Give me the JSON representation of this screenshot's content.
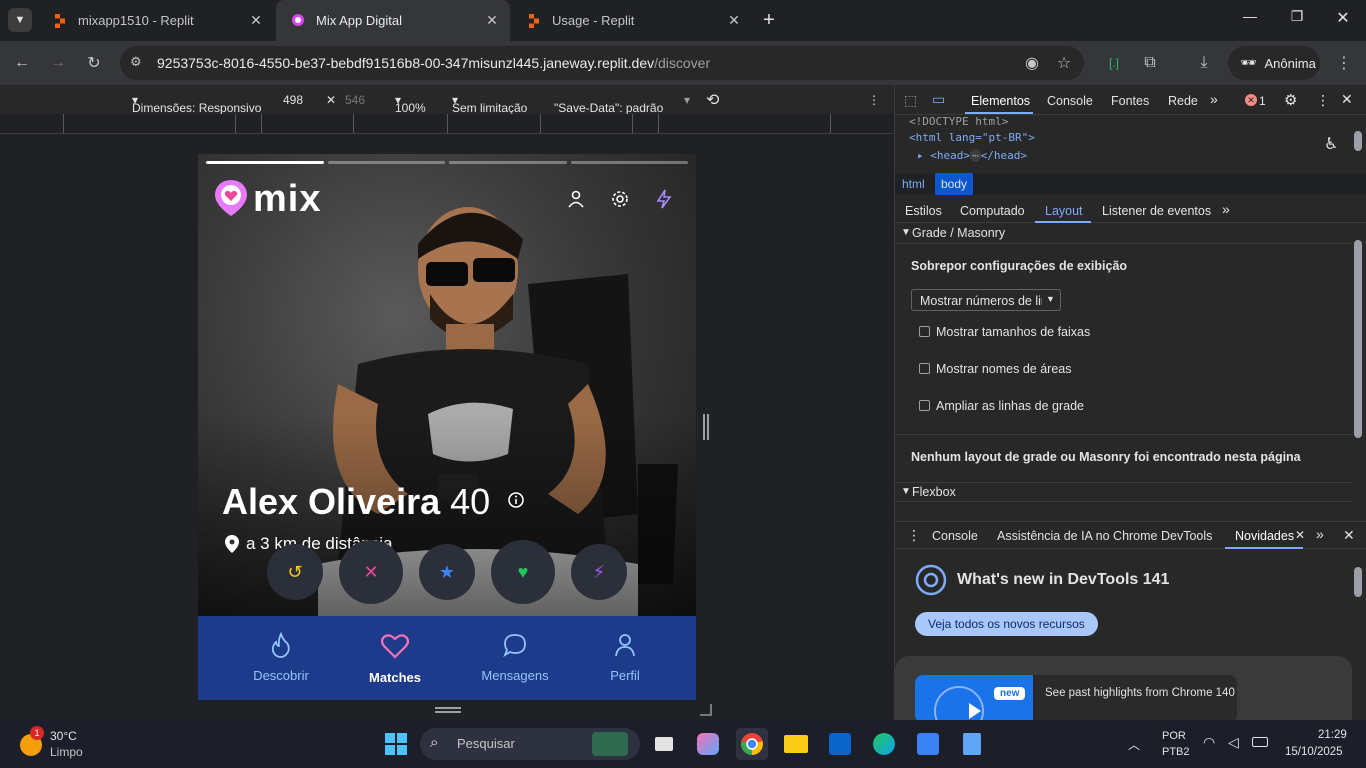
{
  "browser": {
    "tabs": [
      {
        "title": "mixapp1510 - Replit",
        "active": false
      },
      {
        "title": "Mix App Digital",
        "active": true
      },
      {
        "title": "Usage - Replit",
        "active": false
      }
    ],
    "url_host": "9253753c-8016-4550-be37-bebdf91516b8-00-347misunzl445.janeway.replit.dev",
    "url_path": "/discover",
    "profile_label": "Anônima"
  },
  "device_toolbar": {
    "dimensions_label": "Dimensões: Responsivo",
    "width": "498",
    "height": "546",
    "zoom": "100%",
    "throttle": "Sem limitação",
    "save_data": "\"Save-Data\": padrão"
  },
  "app": {
    "logo_text": "mix",
    "profile": {
      "name": "Alex Oliveira",
      "age": "40",
      "distance": "a 3 km de distância"
    },
    "progress_segments": 4,
    "active_segment": 0,
    "actions": [
      {
        "icon": "undo-icon",
        "glyph": "↺",
        "color": "#facc15"
      },
      {
        "icon": "close-icon",
        "glyph": "✕",
        "color": "#ec4899"
      },
      {
        "icon": "star-icon",
        "glyph": "★",
        "color": "#3b82f6"
      },
      {
        "icon": "heart-icon",
        "glyph": "♥",
        "color": "#22c55e"
      },
      {
        "icon": "bolt-icon",
        "glyph": "⚡",
        "color": "#a855f7"
      }
    ],
    "nav": [
      {
        "label": "Descobrir",
        "icon": "flame-icon",
        "active": false
      },
      {
        "label": "Matches",
        "icon": "heart-icon",
        "active": true
      },
      {
        "label": "Mensagens",
        "icon": "message-icon",
        "active": false
      },
      {
        "label": "Perfil",
        "icon": "user-icon",
        "active": false
      }
    ],
    "colors": {
      "nav_bg": "#1e3a8a",
      "accent_pink": "#ec4899",
      "accent_purple": "#a78bfa"
    }
  },
  "devtools": {
    "main_tabs": [
      "Elementos",
      "Console",
      "Fontes",
      "Rede"
    ],
    "error_count": "1",
    "dom_lines": [
      "<!DOCTYPE html>",
      "<html lang=\"pt-BR\">",
      "<head>",
      "</head>"
    ],
    "breadcrumb": [
      "html",
      "body"
    ],
    "sub_tabs": [
      "Estilos",
      "Computado",
      "Layout",
      "Listener de eventos"
    ],
    "grid_section": "Grade / Masonry",
    "overlay_title": "Sobrepor configurações de exibição",
    "overlay_select": "Mostrar números de lir",
    "checkboxes": [
      "Mostrar tamanhos de faixas",
      "Mostrar nomes de áreas",
      "Ampliar as linhas de grade"
    ],
    "no_grid_msg": "Nenhum layout de grade ou Masonry foi encontrado nesta página",
    "flexbox_section": "Flexbox",
    "drawer_tabs": [
      "Console",
      "Assistência de IA no Chrome DevTools",
      "Novidades"
    ],
    "whats_new_title": "What's new in DevTools 141",
    "whats_new_button": "Veja todos os novos recursos",
    "highlight_badge": "new",
    "highlight_text": "See past highlights from Chrome 140"
  },
  "taskbar": {
    "weather_temp": "30°C",
    "weather_desc": "Limpo",
    "weather_badge": "1",
    "search_placeholder": "Pesquisar",
    "lang1": "POR",
    "lang2": "PTB2",
    "time": "21:29",
    "date": "15/10/2025"
  }
}
